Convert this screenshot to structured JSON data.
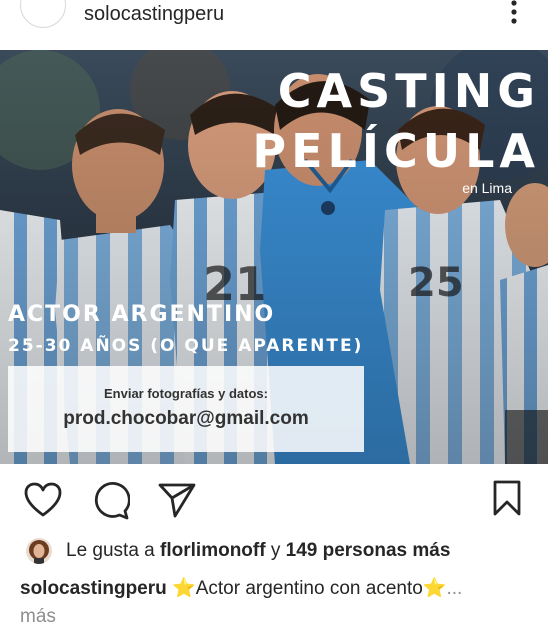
{
  "header": {
    "username": "solocastingperu",
    "more_icon": "more-vertical-icon"
  },
  "post": {
    "title_line1": "CASTING",
    "title_line2": "PELÍCULA",
    "location": "en Lima",
    "role": "ACTOR ARGENTINO",
    "age": "25-30 AÑOS (O QUE APARENTE)",
    "contact_label": "Enviar fotografías y datos:",
    "contact_email": "prod.chocobar@gmail.com",
    "colors": {
      "jersey_blue": "#75aadb",
      "training_blue": "#3a8fd6",
      "text": "#ffffff"
    }
  },
  "actions": {
    "like_icon": "heart-icon",
    "comment_icon": "comment-icon",
    "share_icon": "paper-plane-icon",
    "save_icon": "bookmark-icon"
  },
  "likes": {
    "prefix": "Le gusta a",
    "user": "florlimonoff",
    "connector": "y",
    "others": "149 personas más"
  },
  "caption": {
    "username": "solocastingperu",
    "star": "⭐",
    "text": "Actor argentino con acento",
    "ellipsis": "...",
    "more": "más"
  }
}
